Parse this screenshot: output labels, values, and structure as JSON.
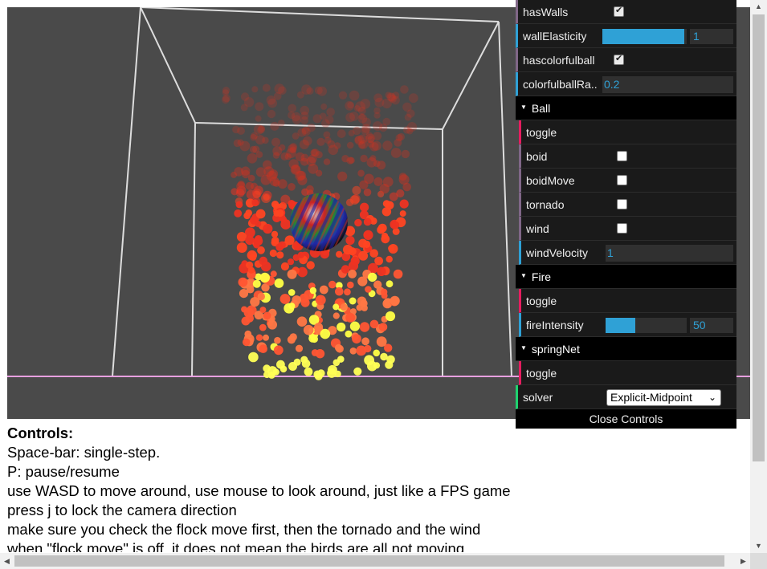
{
  "gui": {
    "hasWalls": {
      "label": "hasWalls",
      "checked": true
    },
    "wallElasticity": {
      "label": "wallElasticity",
      "value": "1",
      "fill": 1.0
    },
    "hascolorfulball": {
      "label": "hascolorfulball",
      "checked": true
    },
    "colorfulballRadius": {
      "label": "colorfulballRa..",
      "value": "0.2"
    },
    "ball_folder": {
      "label": "Ball"
    },
    "ball": {
      "toggle": "toggle",
      "boid": {
        "label": "boid",
        "checked": false
      },
      "boidMove": {
        "label": "boidMove",
        "checked": false
      },
      "tornado": {
        "label": "tornado",
        "checked": false
      },
      "wind": {
        "label": "wind",
        "checked": false
      },
      "windVelocity": {
        "label": "windVelocity",
        "value": "1"
      }
    },
    "fire_folder": {
      "label": "Fire"
    },
    "fire": {
      "toggle": "toggle",
      "fireIntensity": {
        "label": "fireIntensity",
        "value": "50",
        "fill": 0.35
      }
    },
    "springnet_folder": {
      "label": "springNet"
    },
    "springnet": {
      "toggle": "toggle"
    },
    "solver": {
      "label": "solver",
      "selected": "Explicit-Midpoint"
    },
    "close_label": "Close Controls"
  },
  "controls_text": {
    "heading": "Controls:",
    "lines": [
      "Space-bar: single-step.",
      "P: pause/resume",
      "use WASD to move around, use mouse to look around, just like a FPS game",
      "press j to lock the camera direction",
      "make sure you check the flock move first, then the tornado and the wind",
      "when \"flock move\" is off, it does not mean the birds are all not moving"
    ]
  },
  "colors": {
    "viewport_bg": "#4a4a4a",
    "slider_fill": "#2fa1d6",
    "particle_yellow": "#ffff55",
    "particle_red": "#ff4422",
    "floor_line": "#e8a0e0"
  }
}
